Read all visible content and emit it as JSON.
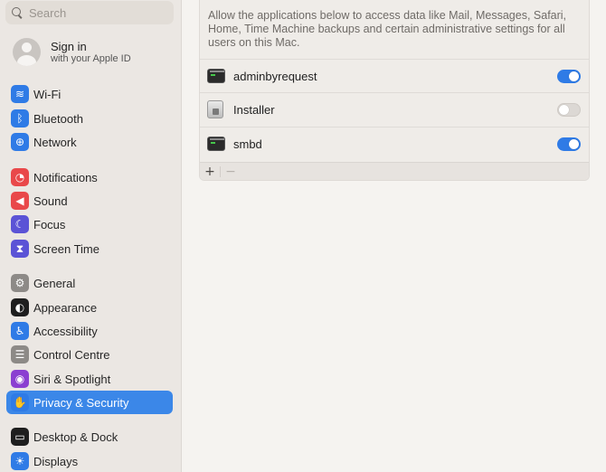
{
  "search": {
    "placeholder": "Search"
  },
  "account": {
    "title": "Sign in",
    "subtitle": "with your Apple ID"
  },
  "sidebar": {
    "items": [
      {
        "label": "Wi-Fi",
        "icon": "wifi-icon",
        "color": "#2f7be6",
        "glyph": "≋"
      },
      {
        "label": "Bluetooth",
        "icon": "bluetooth-icon",
        "color": "#2f7be6",
        "glyph": "ᛒ"
      },
      {
        "label": "Network",
        "icon": "globe-icon",
        "color": "#2f7be6",
        "glyph": "⊕"
      },
      {
        "label": "Notifications",
        "icon": "bell-icon",
        "color": "#e9484a",
        "glyph": "◔"
      },
      {
        "label": "Sound",
        "icon": "speaker-icon",
        "color": "#e9484a",
        "glyph": "◀"
      },
      {
        "label": "Focus",
        "icon": "moon-icon",
        "color": "#5b53d6",
        "glyph": "☾"
      },
      {
        "label": "Screen Time",
        "icon": "hourglass-icon",
        "color": "#5b53d6",
        "glyph": "⧗"
      },
      {
        "label": "General",
        "icon": "gear-icon",
        "color": "#8d8a87",
        "glyph": "⚙"
      },
      {
        "label": "Appearance",
        "icon": "appearance-icon",
        "color": "#1e1e1e",
        "glyph": "◐"
      },
      {
        "label": "Accessibility",
        "icon": "accessibility-icon",
        "color": "#2f7be6",
        "glyph": "♿"
      },
      {
        "label": "Control Centre",
        "icon": "switches-icon",
        "color": "#8d8a87",
        "glyph": "☰"
      },
      {
        "label": "Siri & Spotlight",
        "icon": "siri-icon",
        "color": "#8b3fd1",
        "glyph": "◉"
      },
      {
        "label": "Privacy & Security",
        "icon": "hand-icon",
        "color": "#2f7be6",
        "glyph": "✋",
        "active": true
      },
      {
        "label": "Desktop & Dock",
        "icon": "dock-icon",
        "color": "#1e1e1e",
        "glyph": "▭"
      },
      {
        "label": "Displays",
        "icon": "sun-icon",
        "color": "#2f7be6",
        "glyph": "☀"
      }
    ]
  },
  "main": {
    "description": "Allow the applications below to access data like Mail, Messages, Safari, Home, Time Machine backups and certain administrative settings for all users on this Mac.",
    "apps": [
      {
        "name": "adminbyrequest",
        "icon": "terminal-icon",
        "enabled": true
      },
      {
        "name": "Installer",
        "icon": "installer-icon",
        "enabled": false
      },
      {
        "name": "smbd",
        "icon": "terminal-icon",
        "enabled": true
      }
    ],
    "footer": {
      "add_label": "+",
      "remove_label": "−"
    }
  }
}
